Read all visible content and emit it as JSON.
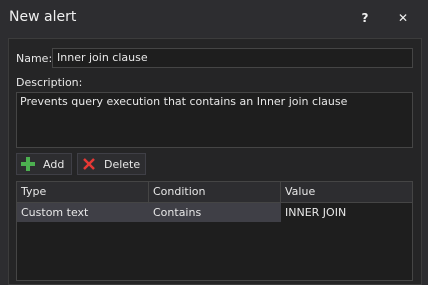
{
  "window": {
    "title": "New alert",
    "help_glyph": "?",
    "close_glyph": "✕"
  },
  "form": {
    "name_label": "Name:",
    "name_value": "Inner join clause",
    "description_label": "Description:",
    "description_value": "Prevents query execution that contains an Inner join clause"
  },
  "toolbar": {
    "add_label": "Add",
    "delete_label": "Delete"
  },
  "grid": {
    "columns": [
      "Type",
      "Condition",
      "Value"
    ],
    "rows": [
      [
        "Custom text",
        "Contains",
        "INNER JOIN"
      ]
    ]
  },
  "colors": {
    "add_icon": "#4caf50",
    "delete_icon": "#e53935"
  }
}
